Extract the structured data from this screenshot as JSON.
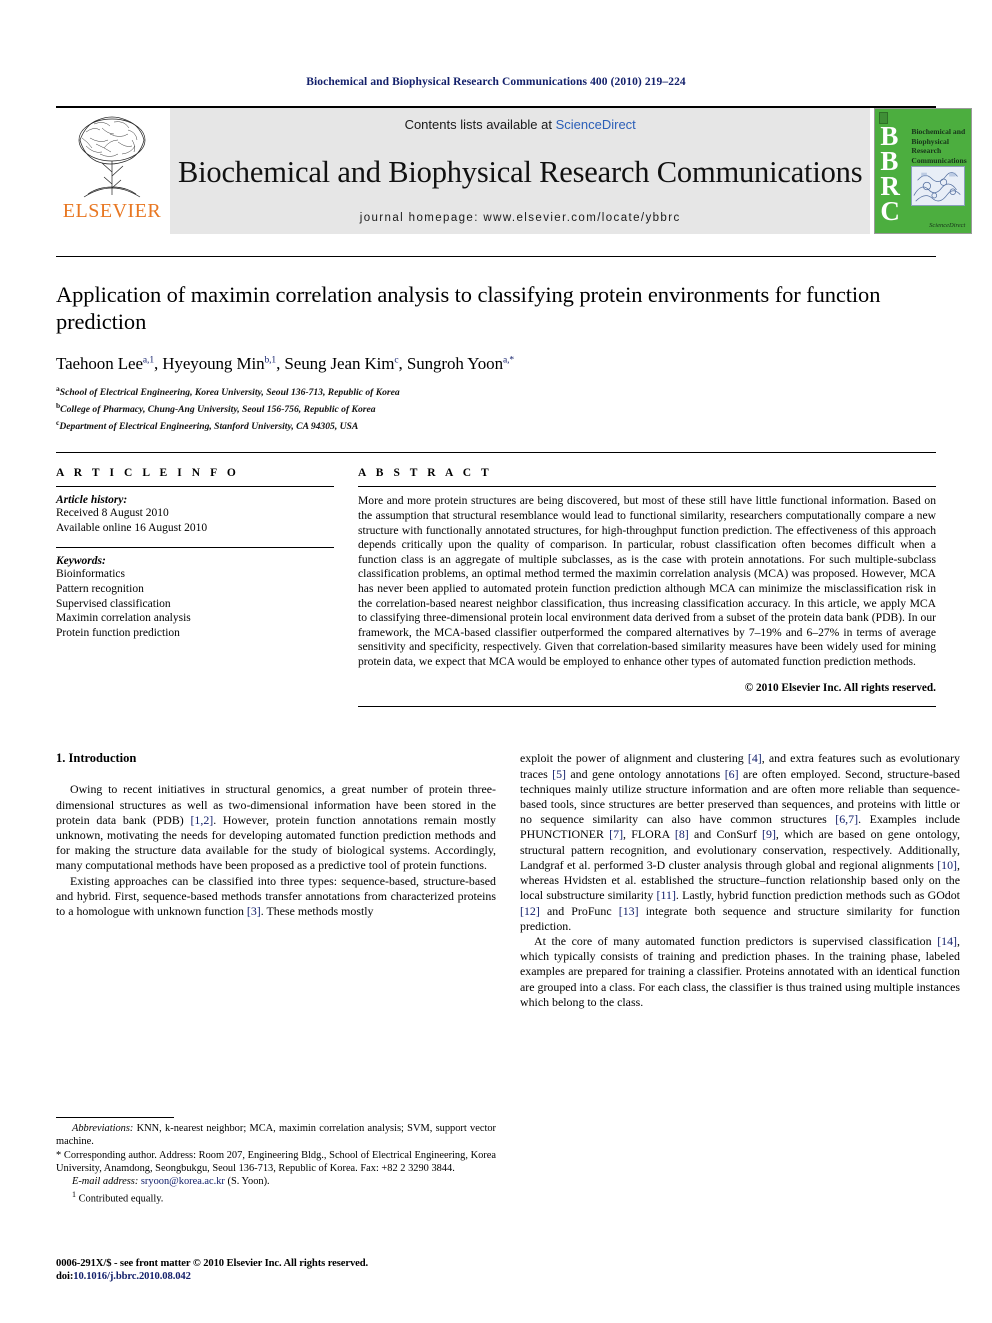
{
  "running_head": "Biochemical and Biophysical Research Communications 400 (2010) 219–224",
  "masthead": {
    "publisher_name": "ELSEVIER",
    "publisher_color": "#e87722",
    "contents_prefix": "Contents lists available at ",
    "contents_link": "ScienceDirect",
    "link_color": "#2b5fb8",
    "journal_title": "Biochemical and Biophysical Research Communications",
    "homepage": "journal homepage: www.elsevier.com/locate/ybbrc",
    "cover": {
      "letters": [
        "B",
        "B",
        "R",
        "C"
      ],
      "title": "Biochemical and Biophysical Research Communications",
      "footer": "ScienceDirect",
      "background_color": "#4cae3f"
    }
  },
  "article": {
    "title": "Application of maximin correlation analysis to classifying protein environments for function prediction",
    "authors": [
      {
        "name": "Taehoon Lee",
        "marks": "a,1"
      },
      {
        "name": "Hyeyoung Min",
        "marks": "b,1"
      },
      {
        "name": "Seung Jean Kim",
        "marks": "c"
      },
      {
        "name": "Sungroh Yoon",
        "marks": "a,*"
      }
    ],
    "affiliations": [
      {
        "mark": "a",
        "text": "School of Electrical Engineering, Korea University, Seoul 136-713, Republic of Korea"
      },
      {
        "mark": "b",
        "text": "College of Pharmacy, Chung-Ang University, Seoul 156-756, Republic of Korea"
      },
      {
        "mark": "c",
        "text": "Department of Electrical Engineering, Stanford University, CA 94305, USA"
      }
    ]
  },
  "article_info": {
    "heading": "A R T I C L E  I N F O",
    "history_label": "Article history:",
    "history": [
      "Received 8 August 2010",
      "Available online 16 August 2010"
    ],
    "keywords_label": "Keywords:",
    "keywords": [
      "Bioinformatics",
      "Pattern recognition",
      "Supervised classification",
      "Maximin correlation analysis",
      "Protein function prediction"
    ]
  },
  "abstract": {
    "heading": "A B S T R A C T",
    "text": "More and more protein structures are being discovered, but most of these still have little functional information. Based on the assumption that structural resemblance would lead to functional similarity, researchers computationally compare a new structure with functionally annotated structures, for high-throughput function prediction. The effectiveness of this approach depends critically upon the quality of comparison. In particular, robust classification often becomes difficult when a function class is an aggregate of multiple subclasses, as is the case with protein annotations. For such multiple-subclass classification problems, an optimal method termed the maximin correlation analysis (MCA) was proposed. However, MCA has never been applied to automated protein function prediction although MCA can minimize the misclassification risk in the correlation-based nearest neighbor classification, thus increasing classification accuracy. In this article, we apply MCA to classifying three-dimensional protein local environment data derived from a subset of the protein data bank (PDB). In our framework, the MCA-based classifier outperformed the compared alternatives by 7–19% and 6–27% in terms of average sensitivity and specificity, respectively. Given that correlation-based similarity measures have been widely used for mining protein data, we expect that MCA would be employed to enhance other types of automated function prediction methods.",
    "copyright": "© 2010 Elsevier Inc. All rights reserved."
  },
  "body": {
    "section_title": "1. Introduction",
    "left_paragraphs": [
      {
        "segments": [
          {
            "t": "Owing to recent initiatives in structural genomics, a great number of protein three-dimensional structures as well as two-dimensional information have been stored in the protein data bank (PDB) "
          },
          {
            "t": "[1,2]",
            "ref": true
          },
          {
            "t": ". However, protein function annotations remain mostly unknown, motivating the needs for developing automated function prediction methods and for making the structure data available for the study of biological systems. Accordingly, many computational methods have been proposed as a predictive tool of protein functions."
          }
        ]
      },
      {
        "segments": [
          {
            "t": "Existing approaches can be classified into three types: sequence-based, structure-based and hybrid. First, sequence-based methods transfer annotations from characterized proteins to a homologue with unknown function "
          },
          {
            "t": "[3]",
            "ref": true
          },
          {
            "t": ". These methods mostly"
          }
        ]
      }
    ],
    "right_paragraphs": [
      {
        "segments": [
          {
            "t": "exploit the power of alignment and clustering "
          },
          {
            "t": "[4]",
            "ref": true
          },
          {
            "t": ", and extra features such as evolutionary traces "
          },
          {
            "t": "[5]",
            "ref": true
          },
          {
            "t": " and gene ontology annotations "
          },
          {
            "t": "[6]",
            "ref": true
          },
          {
            "t": " are often employed. Second, structure-based techniques mainly utilize structure information and are often more reliable than sequence-based tools, since structures are better preserved than sequences, and proteins with little or no sequence similarity can also have common structures "
          },
          {
            "t": "[6,7]",
            "ref": true
          },
          {
            "t": ". Examples include PHUNCTIONER "
          },
          {
            "t": "[7]",
            "ref": true
          },
          {
            "t": ", FLORA "
          },
          {
            "t": "[8]",
            "ref": true
          },
          {
            "t": " and ConSurf "
          },
          {
            "t": "[9]",
            "ref": true
          },
          {
            "t": ", which are based on gene ontology, structural pattern recognition, and evolutionary conservation, respectively. Additionally, Landgraf et al. performed 3-D cluster analysis through global and regional alignments "
          },
          {
            "t": "[10]",
            "ref": true
          },
          {
            "t": ", whereas Hvidsten et al. established the structure–function relationship based only on the local substructure similarity "
          },
          {
            "t": "[11]",
            "ref": true
          },
          {
            "t": ". Lastly, hybrid function prediction methods such as GOdot "
          },
          {
            "t": "[12]",
            "ref": true
          },
          {
            "t": " and ProFunc "
          },
          {
            "t": "[13]",
            "ref": true
          },
          {
            "t": " integrate both sequence and structure similarity for function prediction."
          }
        ]
      },
      {
        "segments": [
          {
            "t": "At the core of many automated function predictors is supervised classification "
          },
          {
            "t": "[14]",
            "ref": true
          },
          {
            "t": ", which typically consists of training and prediction phases. In the training phase, labeled examples are prepared for training a classifier. Proteins annotated with an identical function are grouped into a class. For each class, the classifier is thus trained using multiple instances which belong to the class."
          }
        ]
      }
    ]
  },
  "footnotes": {
    "abbreviations_label": "Abbreviations:",
    "abbreviations_text": " KNN, k-nearest neighbor; MCA, maximin correlation analysis; SVM, support vector machine.",
    "corresponding_mark": "*",
    "corresponding_text": " Corresponding author. Address: Room 207, Engineering Bldg., School of Electrical Engineering, Korea University, Anamdong, Seongbukgu, Seoul 136-713, Republic of Korea. Fax: +82 2 3290 3844.",
    "email_label": "E-mail address:",
    "email": "sryoon@korea.ac.kr",
    "email_suffix": " (S. Yoon).",
    "equal_mark": "1",
    "equal_text": " Contributed equally."
  },
  "page_footer": {
    "issn_line": "0006-291X/$ - see front matter © 2010 Elsevier Inc. All rights reserved.",
    "doi_prefix": "doi:",
    "doi": "10.1016/j.bbrc.2010.08.042"
  }
}
